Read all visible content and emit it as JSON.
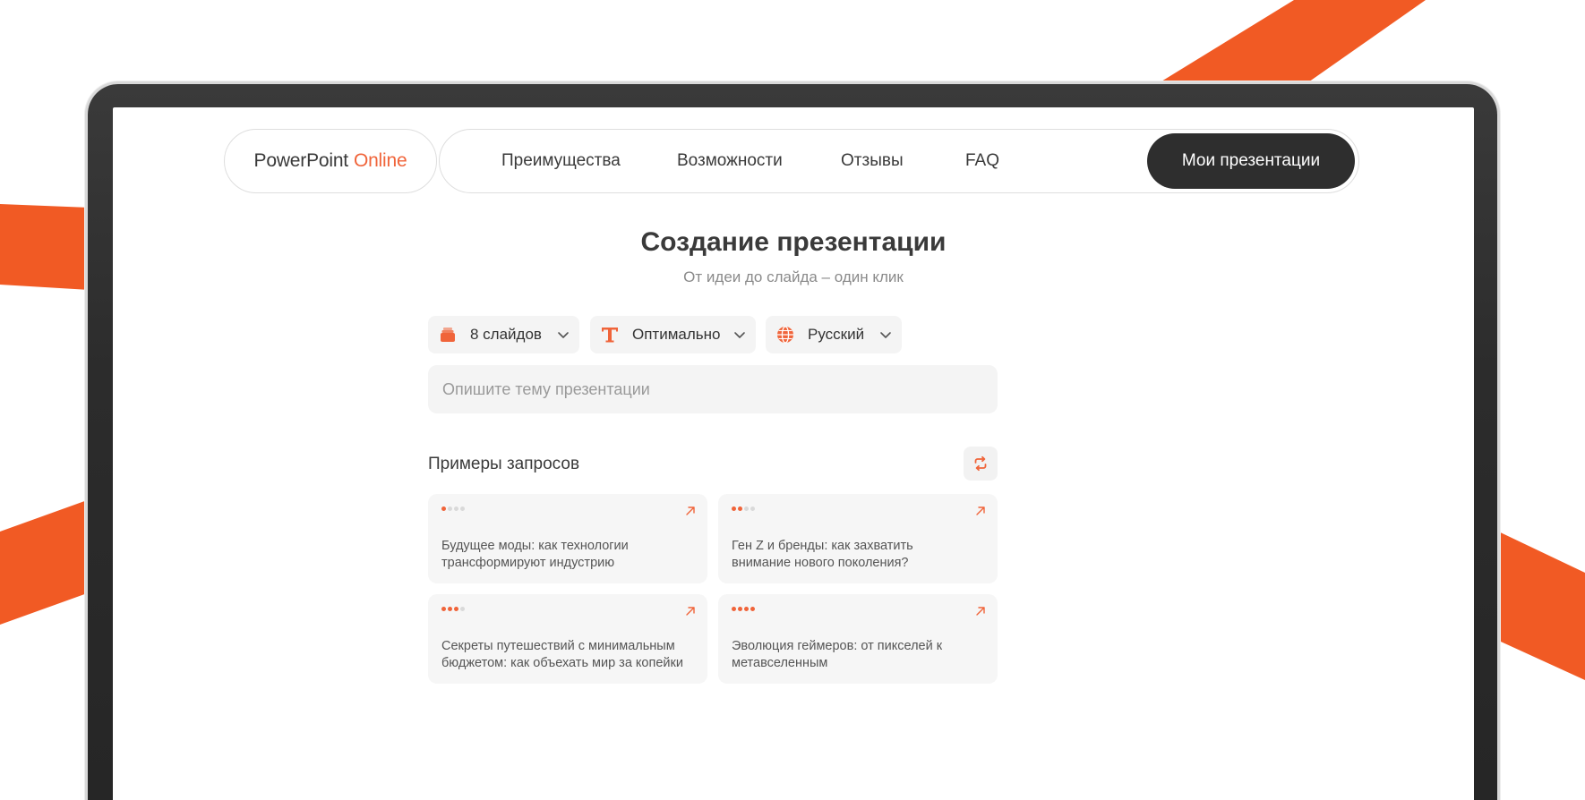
{
  "colors": {
    "accent": "#f0643a",
    "ribbon": "#f15a24",
    "frame": "#2c2c2c",
    "cta_bg": "#2e2e2e"
  },
  "logo": {
    "main": "PowerPoint",
    "accent": "Online"
  },
  "nav": {
    "links": [
      "Преимущества",
      "Возможности",
      "Отзывы",
      "FAQ"
    ],
    "cta": "Мои презентации"
  },
  "hero": {
    "title": "Создание презентации",
    "subtitle": "От идеи до слайда – один клик"
  },
  "options": {
    "slides": {
      "icon": "slides-stack-icon",
      "value": "8 слайдов"
    },
    "text_amount": {
      "icon": "text-t-icon",
      "value": "Оптимально"
    },
    "language": {
      "icon": "globe-icon",
      "value": "Русский"
    }
  },
  "topic_input": {
    "placeholder": "Опишите тему презентации",
    "value": ""
  },
  "examples": {
    "title": "Примеры запросов",
    "refresh_icon": "refresh-icon",
    "items": [
      {
        "level": 1,
        "text": "Будущее моды: как технологии трансформируют индустрию"
      },
      {
        "level": 2,
        "text": "Ген Z и бренды: как захватить внимание нового поколения?"
      },
      {
        "level": 3,
        "text": "Секреты путешествий с минимальным бюджетом: как объехать мир за копейки"
      },
      {
        "level": 4,
        "text": "Эволюция геймеров: от пикселей к метавселенным"
      }
    ]
  }
}
